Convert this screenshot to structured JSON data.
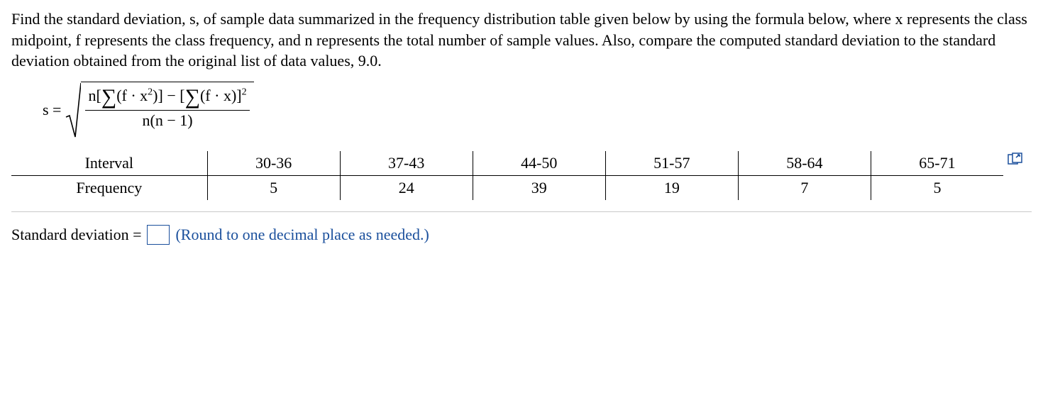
{
  "question": {
    "text": "Find the standard deviation, s, of sample data summarized in the frequency distribution table given below by using the formula below, where x represents the class midpoint, f represents the class frequency, and n represents the total number of sample values. Also, compare the computed standard deviation to the standard deviation obtained from the original list of data values, 9.0."
  },
  "formula": {
    "lhs": "s =",
    "num_prefix": "n",
    "sum_fx2_open": "[",
    "sum_fx2_inner": "(f · x",
    "sum_fx2_exp": "2",
    "sum_fx2_close": ")]",
    "minus": "−",
    "sum_fx_open": "[",
    "sum_fx_inner": "(f · x)",
    "sum_fx_close": "]",
    "outer_exp": "2",
    "den": "n(n − 1)",
    "sigma": "∑"
  },
  "table": {
    "row1_label": "Interval",
    "row2_label": "Frequency",
    "intervals": [
      "30-36",
      "37-43",
      "44-50",
      "51-57",
      "58-64",
      "65-71"
    ],
    "frequencies": [
      "5",
      "24",
      "39",
      "19",
      "7",
      "5"
    ]
  },
  "answer": {
    "label": "Standard deviation =",
    "hint": "(Round to one decimal place as needed.)",
    "value": ""
  },
  "chart_data": {
    "type": "table",
    "title": "Frequency distribution",
    "columns": [
      "Interval",
      "Frequency"
    ],
    "rows": [
      {
        "Interval": "30-36",
        "Frequency": 5
      },
      {
        "Interval": "37-43",
        "Frequency": 24
      },
      {
        "Interval": "44-50",
        "Frequency": 39
      },
      {
        "Interval": "51-57",
        "Frequency": 19
      },
      {
        "Interval": "58-64",
        "Frequency": 7
      },
      {
        "Interval": "65-71",
        "Frequency": 5
      }
    ],
    "given_original_sd": 9.0
  }
}
